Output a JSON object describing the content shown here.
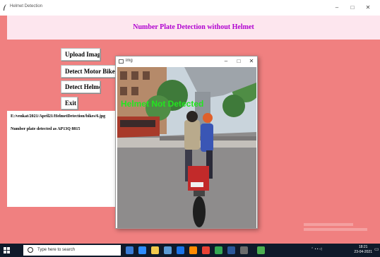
{
  "window": {
    "title": "Helmet Detection",
    "minimize_label": "–",
    "maximize_label": "□",
    "close_label": "✕"
  },
  "header": {
    "heading": "Number Plate Detection without Helmet"
  },
  "buttons": {
    "upload": "Upload Image",
    "detect_motor": "Detect Motor Bike & Person",
    "detect_helmet": "Detect Helmet",
    "exit": "Exit"
  },
  "output": {
    "file_path": "E:/venkat/2021/April21/HelmetDetection/bikes/6.jpg",
    "result": "Number plate detected as AP13Q 8815"
  },
  "image_window": {
    "title": "img",
    "minimize_label": "–",
    "maximize_label": "□",
    "close_label": "✕",
    "overlay_text": "Helmet Not Detected",
    "overlay_color": "#22e61f"
  },
  "taskbar": {
    "search_placeholder": "Type here to search",
    "time": "18:21",
    "date": "23-04-2021"
  },
  "colors": {
    "background": "#f08080",
    "heading_band": "#fde6ee",
    "heading_text": "#b000d0",
    "taskbar": "#0f1a2a"
  }
}
